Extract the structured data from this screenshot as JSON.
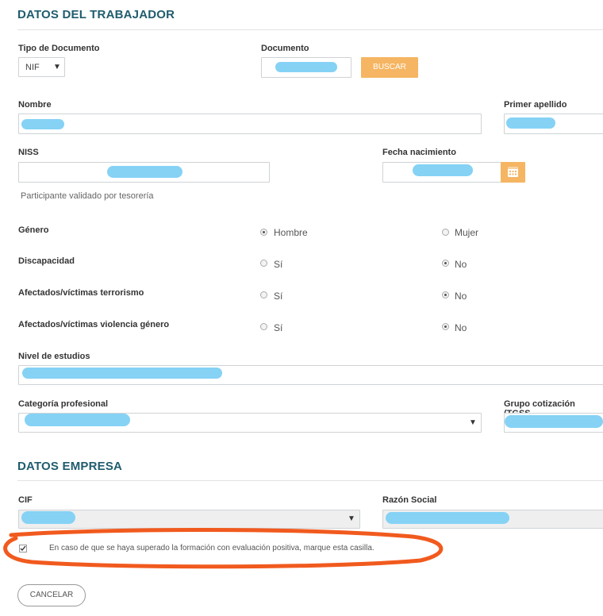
{
  "worker": {
    "title": "DATOS DEL TRABAJADOR",
    "doc_type": {
      "label": "Tipo de Documento",
      "value": "NIF"
    },
    "document": {
      "label": "Documento",
      "search_label": "BUSCAR"
    },
    "nombre_label": "Nombre",
    "primer_apellido_label": "Primer apellido",
    "niss_label": "NISS",
    "fecha_label": "Fecha nacimiento",
    "validated_note": "Participante validado por tesorería",
    "genero": {
      "label": "Género",
      "opt1": "Hombre",
      "opt2": "Mujer",
      "selected": "Hombre"
    },
    "discapacidad": {
      "label": "Discapacidad",
      "opt1": "Sí",
      "opt2": "No",
      "selected": "No"
    },
    "terrorismo": {
      "label": "Afectados/víctimas terrorismo",
      "opt1": "Sí",
      "opt2": "No",
      "selected": "No"
    },
    "violencia": {
      "label": "Afectados/víctimas violencia género",
      "opt1": "Sí",
      "opt2": "No",
      "selected": "No"
    },
    "nivel_label": "Nivel de estudios",
    "categoria_label": "Categoría profesional",
    "grupo_label": "Grupo cotización (TGSS"
  },
  "company": {
    "title": "DATOS EMPRESA",
    "cif_label": "CIF",
    "razon_label": "Razón Social",
    "checkbox_text": "En caso de que se haya superado la formación con evaluación positiva, marque esta casilla.",
    "checkbox_checked": true
  },
  "actions": {
    "cancel_label": "CANCELAR"
  },
  "colors": {
    "accent": "#f5b562",
    "title": "#1f5c6e",
    "redaction": "#7ed0f4",
    "annotation": "#f15a1e"
  },
  "icons": {
    "calendar": "calendar-icon",
    "caret": "chevron-down-icon",
    "check": "checkmark-icon"
  }
}
